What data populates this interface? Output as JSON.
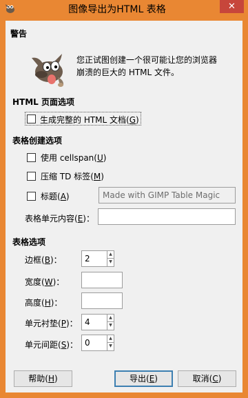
{
  "window": {
    "title": "图像导出为HTML 表格",
    "close_glyph": "✕",
    "icon": "gimp-app-icon"
  },
  "warning": {
    "heading": "警告",
    "line1": "您正试图创建一个很可能让您的浏览器",
    "line2": "崩溃的巨大的 HTML 文件。",
    "icon": "gimp-wilber-mascot"
  },
  "html_page_options": {
    "heading": "HTML 页面选项",
    "full_document_label": "生成完整的 HTML 文档",
    "full_document_mnemonic": "G",
    "full_document_checked": false
  },
  "table_creation_options": {
    "heading": "表格创建选项",
    "cellspan_label": "使用 cellspan",
    "cellspan_mnemonic": "U",
    "cellspan_checked": false,
    "compress_td_label": "压缩 TD 标签",
    "compress_td_mnemonic": "M",
    "compress_td_checked": false,
    "caption_label": "标题",
    "caption_mnemonic": "A",
    "caption_checked": false,
    "caption_value": "Made with GIMP Table Magic",
    "cell_content_label": "表格单元内容",
    "cell_content_mnemonic": "E",
    "cell_content_value": ""
  },
  "table_options": {
    "heading": "表格选项",
    "border_label": "边框",
    "border_mnemonic": "B",
    "border_value": "2",
    "width_label": "宽度",
    "width_mnemonic": "W",
    "width_value": "",
    "height_label": "高度",
    "height_mnemonic": "H",
    "height_value": "",
    "cell_padding_label": "单元衬垫",
    "cell_padding_mnemonic": "P",
    "cell_padding_value": "4",
    "cell_spacing_label": "单元间距",
    "cell_spacing_mnemonic": "S",
    "cell_spacing_value": "0"
  },
  "buttons": {
    "help_label": "帮助",
    "help_mnemonic": "H",
    "export_label": "导出",
    "export_mnemonic": "E",
    "cancel_label": "取消",
    "cancel_mnemonic": "C"
  },
  "colors": {
    "titlebar": "#e98733",
    "close_button": "#c7463b",
    "client_background": "#f0f0f0"
  }
}
